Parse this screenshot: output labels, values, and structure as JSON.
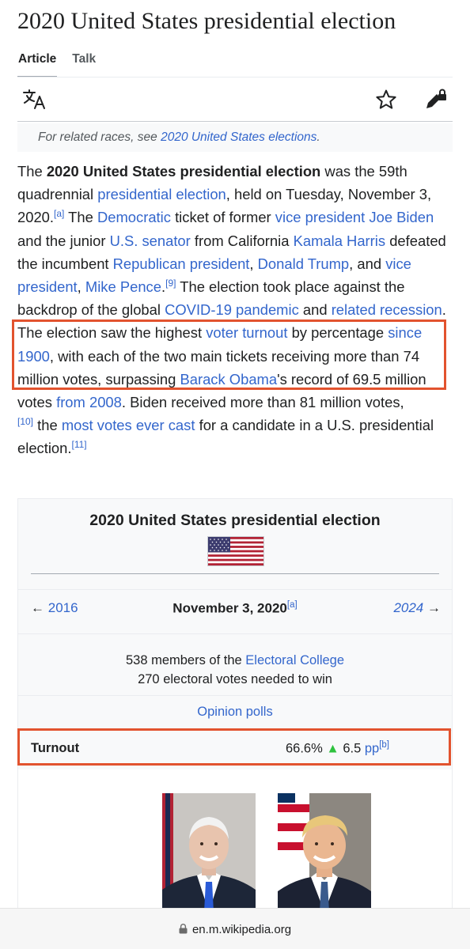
{
  "page": {
    "title": "2020 United States presidential election",
    "tabs": [
      {
        "label": "Article"
      },
      {
        "label": "Talk"
      }
    ]
  },
  "icons": {
    "language": "language-icon",
    "watch": "star-icon",
    "edit": "edit-lock-icon",
    "lock": "lock-icon"
  },
  "hatnote": {
    "prefix": "For related races, see ",
    "link": "2020 United States elections",
    "suffix": "."
  },
  "lead": {
    "t1": "The ",
    "b1": "2020 United States presidential election",
    "t2": " was the 59th quadrennial ",
    "l1": "presidential election",
    "t3": ", held on Tuesday, November 3, 2020.",
    "r1": "[a]",
    "t4": " The ",
    "l2": "Democratic",
    "t5": " ticket of former ",
    "l3": "vice president",
    "t6": " ",
    "l4": "Joe Biden",
    "t7": " and the junior ",
    "l5": "U.S. senator",
    "t8": " from California ",
    "l6": "Kamala Harris",
    "t9": " defeated the incumbent ",
    "l7": "Republican president",
    "t10": ", ",
    "l8": "Donald Trump",
    "t11": ", and ",
    "l9": "vice president",
    "t12": ", ",
    "l10": "Mike Pence",
    "t13": ".",
    "r2": "[9]",
    "t14": " The election took place against the backdrop of the global ",
    "l11": "COVID-19 pandemic",
    "t15": " and ",
    "l12": "related recession",
    "t16": ". The election saw the highest ",
    "l13": "voter turnout",
    "t17": " by percentage ",
    "l14": "since 1900",
    "t18": ", with each of the two main tickets receiving more than 74 million votes, surpassing ",
    "l15": "Barack Obama",
    "t19": "'s record of 69.5 million votes ",
    "l16": "from 2008",
    "t20": ". Biden received more than 81 million votes,",
    "r3": "[10]",
    "t21": " the ",
    "l17": "most votes ever cast",
    "t22": " for a candidate in a U.S. presidential election.",
    "r4": "[11]"
  },
  "infobox": {
    "title": "2020 United States presidential election",
    "flag": "flag-of-the-united-states",
    "prev_arrow": "←",
    "prev": "2016",
    "date": "November 3, 2020",
    "date_ref": "[a]",
    "next": "2024",
    "next_arrow": "→",
    "ec_prefix": "538 members of the ",
    "ec_link": "Electoral College",
    "ec_line2": "270 electoral votes needed to win",
    "polls": "Opinion polls",
    "turnout_label": "Turnout",
    "turnout_value": "66.6%",
    "turnout_arrow": "▲",
    "turnout_change": "6.5",
    "turnout_unit": "pp",
    "turnout_ref": "[b]"
  },
  "browser": {
    "url": "en.m.wikipedia.org"
  },
  "colors": {
    "link": "#3366cc",
    "highlight": "#e2532e",
    "up_arrow": "#2ec23e"
  }
}
